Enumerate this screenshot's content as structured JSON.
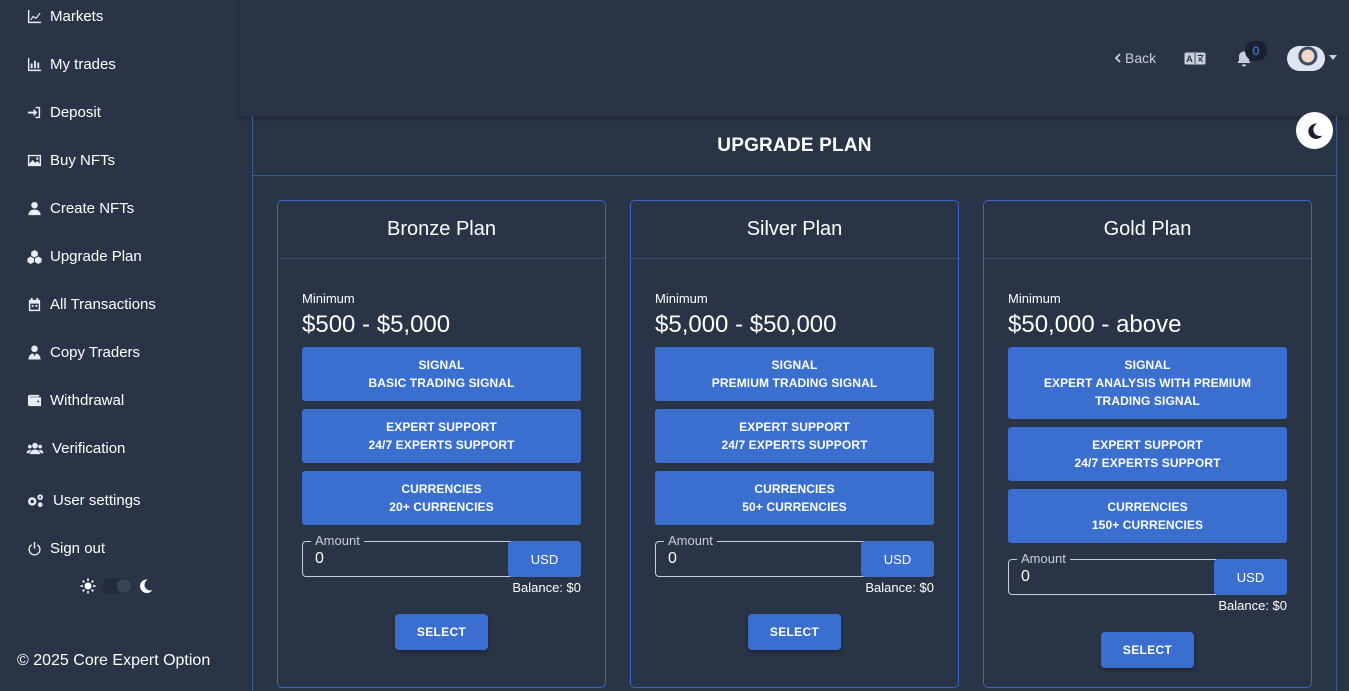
{
  "sidebar": {
    "items": [
      {
        "label": "Markets",
        "icon": "chart-line-icon"
      },
      {
        "label": "My trades",
        "icon": "bar-chart-icon"
      },
      {
        "label": "Deposit",
        "icon": "sign-in-icon"
      },
      {
        "label": "Buy NFTs",
        "icon": "image-icon"
      },
      {
        "label": "Create NFTs",
        "icon": "user-icon"
      },
      {
        "label": "Upgrade Plan",
        "icon": "cubes-icon"
      },
      {
        "label": "All Transactions",
        "icon": "calendar-icon"
      },
      {
        "label": "Copy Traders",
        "icon": "user-tie-icon"
      },
      {
        "label": "Withdrawal",
        "icon": "wallet-icon"
      },
      {
        "label": "Verification",
        "icon": "users-icon"
      },
      {
        "label": "User settings",
        "icon": "cogs-icon"
      },
      {
        "label": "Sign out",
        "icon": "power-icon"
      }
    ],
    "copyright": "© 2025 Core Expert Option"
  },
  "topbar": {
    "back_label": "Back",
    "notification_count": "0"
  },
  "main": {
    "title": "UPGRADE PLAN"
  },
  "plans": [
    {
      "name": "Bronze Plan",
      "min_label": "Minimum",
      "range": "$500 - $5,000",
      "features": [
        {
          "title": "SIGNAL",
          "value": "BASIC TRADING SIGNAL"
        },
        {
          "title": "EXPERT SUPPORT",
          "value": "24/7 EXPERTS SUPPORT"
        },
        {
          "title": "CURRENCIES",
          "value": "20+ CURRENCIES"
        }
      ],
      "amount_label": "Amount",
      "amount_value": "0",
      "currency": "USD",
      "balance": "Balance: $0",
      "select_label": "SELECT"
    },
    {
      "name": "Silver Plan",
      "min_label": "Minimum",
      "range": "$5,000 - $50,000",
      "features": [
        {
          "title": "SIGNAL",
          "value": "PREMIUM TRADING SIGNAL"
        },
        {
          "title": "EXPERT SUPPORT",
          "value": "24/7 EXPERTS SUPPORT"
        },
        {
          "title": "CURRENCIES",
          "value": "50+ CURRENCIES"
        }
      ],
      "amount_label": "Amount",
      "amount_value": "0",
      "currency": "USD",
      "balance": "Balance: $0",
      "select_label": "SELECT"
    },
    {
      "name": "Gold Plan",
      "min_label": "Minimum",
      "range": "$50,000 - above",
      "features": [
        {
          "title": "SIGNAL",
          "value": "EXPERT ANALYSIS WITH PREMIUM TRADING SIGNAL"
        },
        {
          "title": "EXPERT SUPPORT",
          "value": "24/7 EXPERTS SUPPORT"
        },
        {
          "title": "CURRENCIES",
          "value": "150+ CURRENCIES"
        }
      ],
      "amount_label": "Amount",
      "amount_value": "0",
      "currency": "USD",
      "balance": "Balance: $0",
      "select_label": "SELECT"
    }
  ],
  "colors": {
    "background": "#2a3447",
    "accent": "#3b6fcf",
    "card_border": "#3d63c9"
  }
}
